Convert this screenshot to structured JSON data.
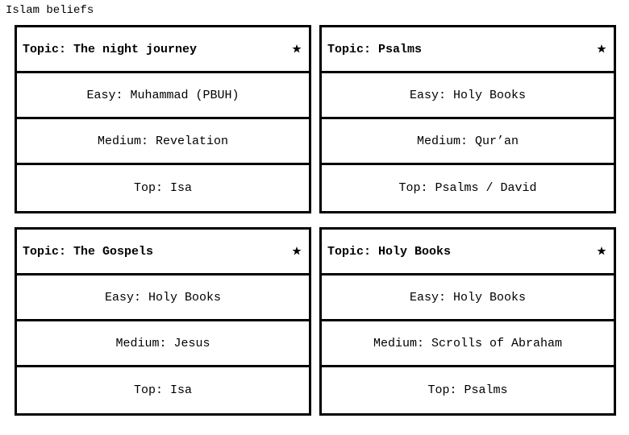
{
  "page": {
    "title": "Islam beliefs"
  },
  "cards": [
    {
      "topic": "Topic: The night journey",
      "icon": "star-and-crescent-icon",
      "easy": "Easy: Muhammad (PBUH)",
      "medium": "Medium: Revelation",
      "top": "Top: Isa"
    },
    {
      "topic": "Topic: Psalms",
      "icon": "star-and-crescent-icon",
      "easy": "Easy: Holy Books",
      "medium": "Medium: Qur’an",
      "top": "Top: Psalms / David"
    },
    {
      "topic": "Topic: The Gospels",
      "icon": "star-and-crescent-icon",
      "easy": "Easy: Holy Books",
      "medium": "Medium: Jesus",
      "top": "Top: Isa"
    },
    {
      "topic": "Topic: Holy Books",
      "icon": "star-and-crescent-icon",
      "easy": "Easy: Holy Books",
      "medium": "Medium: Scrolls of Abraham",
      "top": "Top: Psalms"
    }
  ]
}
